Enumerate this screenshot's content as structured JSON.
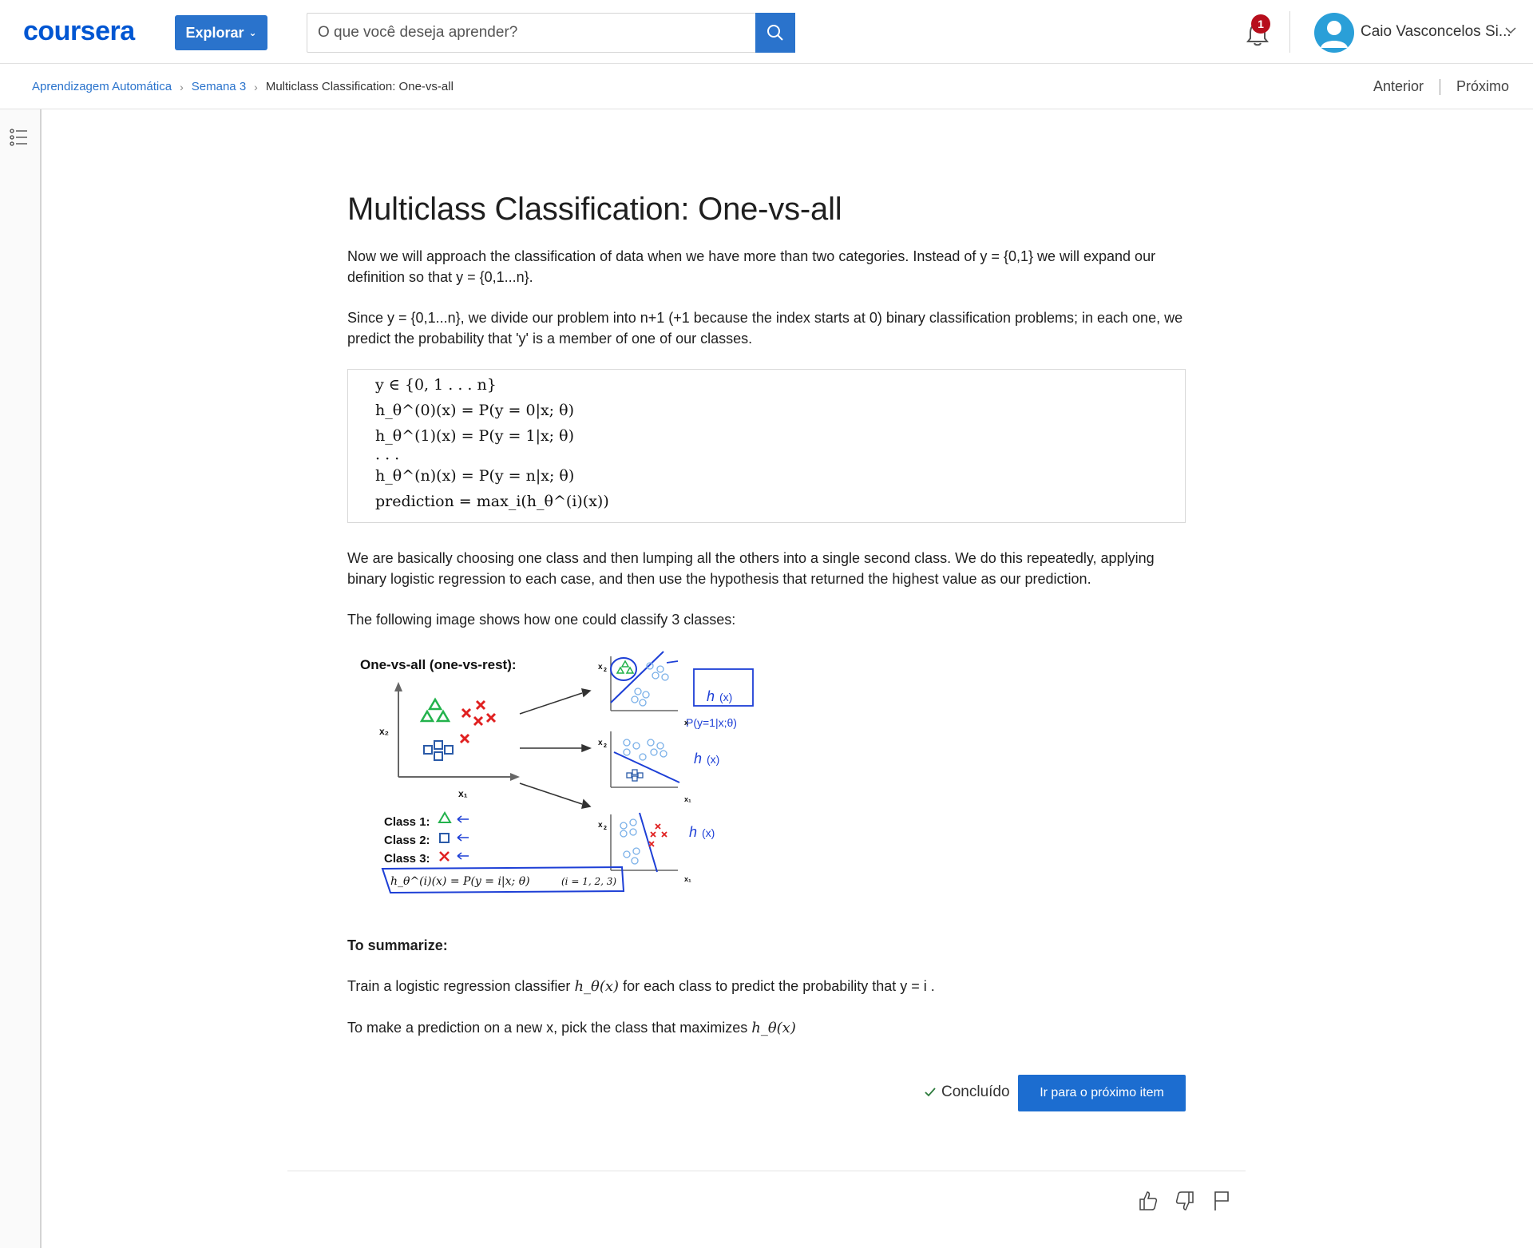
{
  "header": {
    "logo": "coursera",
    "explore_label": "Explorar",
    "search_placeholder": "O que você deseja aprender?",
    "notification_count": "1",
    "user_name": "Caio Vasconcelos Si..."
  },
  "breadcrumb": {
    "items": [
      "Aprendizagem Automática",
      "Semana 3",
      "Multiclass Classification: One-vs-all"
    ]
  },
  "nav": {
    "prev": "Anterior",
    "next": "Próximo"
  },
  "content": {
    "title": "Multiclass Classification: One-vs-all",
    "p1": "Now we will approach the classification of data when we have more than two categories. Instead of y = {0,1} we will expand our definition so that y = {0,1...n}.",
    "p2": "Since y = {0,1...n}, we divide our problem into n+1 (+1 because the index starts at 0) binary classification problems; in each one, we predict the probability that 'y' is a member of one of our classes.",
    "math": {
      "l1": "y ∈ {0, 1 . . . n}",
      "l2": "h_θ^(0)(x) = P(y = 0|x; θ)",
      "l3": "h_θ^(1)(x) = P(y = 1|x; θ)",
      "l4": "· · ·",
      "l5": "h_θ^(n)(x) = P(y = n|x; θ)",
      "l6": "prediction = max_i(h_θ^(i)(x))"
    },
    "p3": "We are basically choosing one class and then lumping all the others into a single second class. We do this repeatedly, applying binary logistic regression to each case, and then use the hypothesis that returned the highest value as our prediction.",
    "p4": "The following image shows how one could classify 3 classes:",
    "figure": {
      "heading": "One-vs-all (one-vs-rest):",
      "class1": "Class 1:",
      "class2": "Class 2:",
      "class3": "Class 3:",
      "axis_x1": "x₁",
      "axis_x2": "x₂",
      "formula": "h_θ^(i)(x) = P(y = i|x; θ)",
      "range": "(i = 1, 2, 3)"
    },
    "summary_label": "To summarize:",
    "p6_a": "Train a logistic regression classifier ",
    "p6_math": "h_θ(x)",
    "p6_b": " for each class to predict the probability that  y = i .",
    "p7_a": "To make a prediction on a new x, pick the class that maximizes ",
    "p7_math": "h_θ(x)",
    "done_label": "Concluído",
    "next_item_label": "Ir para o próximo item"
  },
  "colors": {
    "brand": "#0056d2",
    "button": "#2a73cc",
    "badge": "#b70e1c"
  }
}
